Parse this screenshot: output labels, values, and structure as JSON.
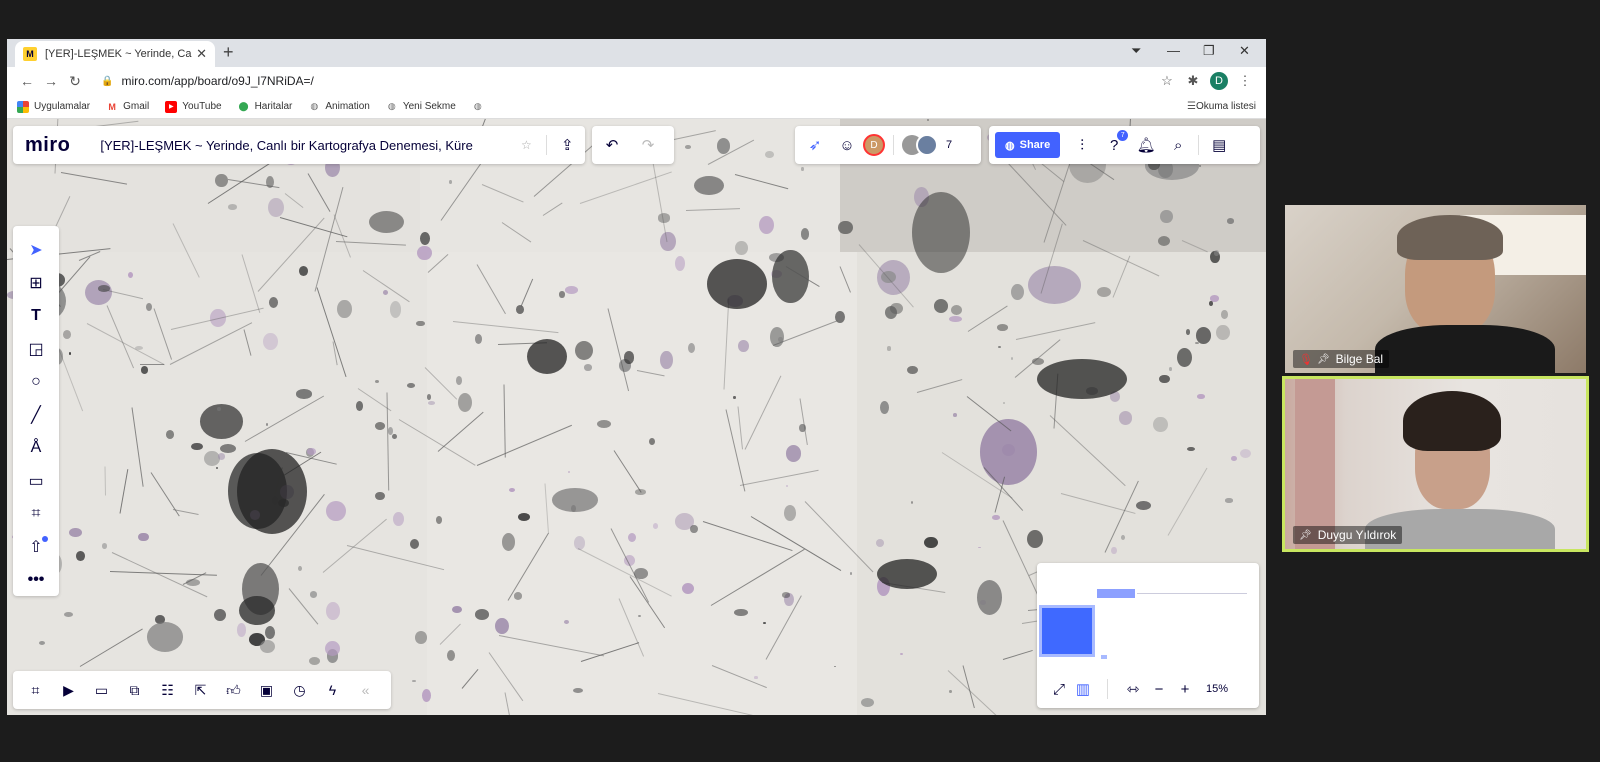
{
  "browser": {
    "tab_title": "[YER]-LEŞMEK ~ Yerinde, Canlı bir",
    "tab_close": "✕",
    "new_tab": "+",
    "url": "miro.com/app/board/o9J_l7NRiDA=/",
    "profile_initial": "D",
    "bookmarks": [
      {
        "label": "Uygulamalar",
        "icon": "apps-grid-icon"
      },
      {
        "label": "Gmail",
        "icon": "gmail-icon"
      },
      {
        "label": "YouTube",
        "icon": "youtube-icon"
      },
      {
        "label": "Haritalar",
        "icon": "maps-pin-icon"
      },
      {
        "label": "Animation",
        "icon": "globe-icon"
      },
      {
        "label": "Yeni Sekme",
        "icon": "globe-icon"
      }
    ],
    "reading_list": "Okuma listesi"
  },
  "miro": {
    "logo": "miro",
    "board_title": "[YER]-LEŞMEK ~ Yerinde, Canlı bir Kartografya Denemesi, Küre",
    "collab_initial": "D",
    "collab_count": "7",
    "share_label": "Share",
    "help_badge": "7",
    "zoom": "15%"
  },
  "participants": [
    {
      "name": "Bilge Bal",
      "muted": true,
      "pinned": true
    },
    {
      "name": "Duygu Yıldırok",
      "muted": false,
      "pinned": true,
      "active": true
    }
  ],
  "colors": {
    "miro_blue": "#4262ff",
    "active_speaker_border": "#c8e660",
    "miro_navy": "#050038"
  }
}
